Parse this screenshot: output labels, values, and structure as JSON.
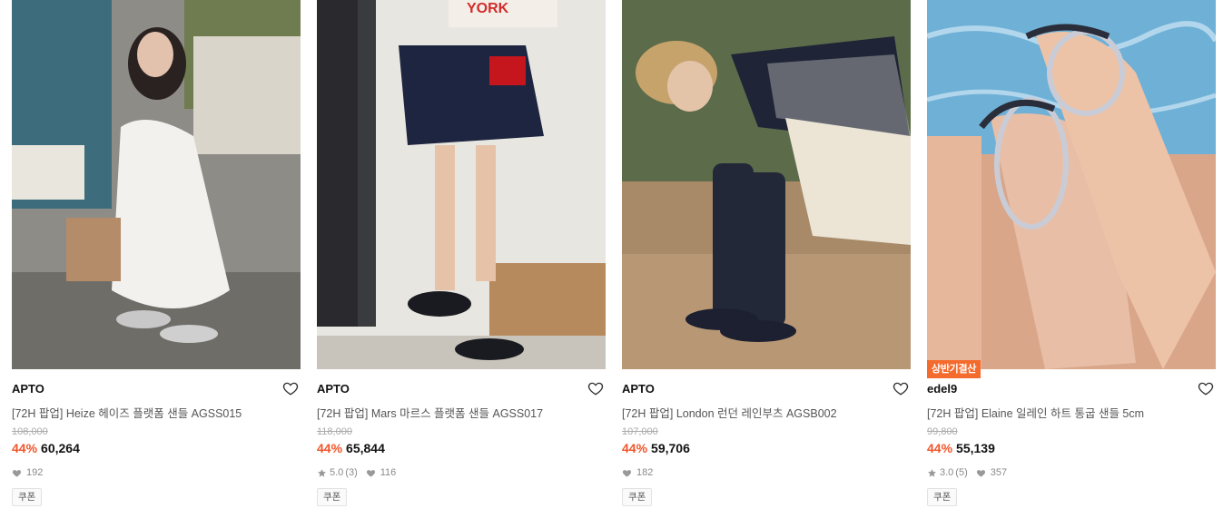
{
  "products": [
    {
      "brand": "APTO",
      "name": "[72H 팝업] Heize 헤이즈 플랫폼 샌들 AGSS015",
      "original_price": "108,000",
      "discount": "44%",
      "price": "60,264",
      "likes": "192",
      "coupon": "쿠폰"
    },
    {
      "brand": "APTO",
      "name": "[72H 팝업] Mars 마르스 플랫폼 샌들 AGSS017",
      "original_price": "118,000",
      "discount": "44%",
      "price": "65,844",
      "rating": "5.0",
      "review_count": "(3)",
      "likes": "116",
      "coupon": "쿠폰"
    },
    {
      "brand": "APTO",
      "name": "[72H 팝업] London 런던 레인부츠 AGSB002",
      "original_price": "107,000",
      "discount": "44%",
      "price": "59,706",
      "likes": "182",
      "coupon": "쿠폰"
    },
    {
      "badge": "상반기결산",
      "brand": "edel9",
      "name": "[72H 팝업] Elaine 일레인 하트 통굽 샌들 5cm",
      "original_price": "99,800",
      "discount": "44%",
      "price": "55,139",
      "rating": "3.0",
      "review_count": "(5)",
      "likes": "357",
      "coupon": "쿠폰"
    }
  ],
  "colors": {
    "discount": "#f0552a",
    "badge": "#f46b2e",
    "meta": "#8a8a8a"
  },
  "icons": {
    "wishlist": "heart-outline-icon",
    "likes": "heart-filled-icon",
    "rating": "star-icon"
  }
}
